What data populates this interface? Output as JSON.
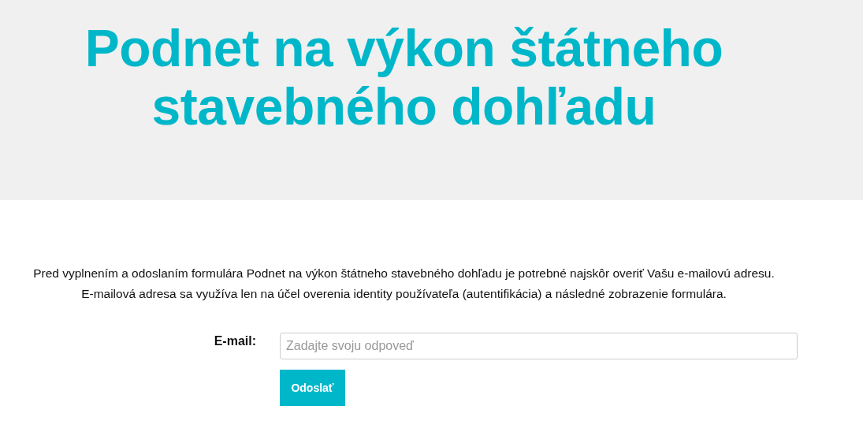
{
  "header": {
    "title_lines": [
      "Podnet na výkon štátneho",
      "stavebného dohľadu"
    ]
  },
  "intro": [
    "Pred vyplnením a odoslaním formulára Podnet na výkon štátneho stavebného dohľadu je potrebné najskôr overiť Vašu e-mailovú adresu.",
    "E-mailová adresa sa využíva len na účel overenia identity používateľa (autentifikácia) a následné zobrazenie formulára."
  ],
  "form": {
    "label": "E-mail:",
    "placeholder": "Zadajte svoju odpoveď",
    "submit": "Odoslať"
  }
}
